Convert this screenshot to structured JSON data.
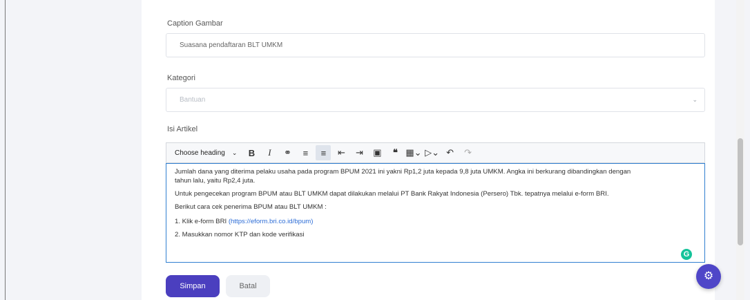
{
  "form": {
    "caption_label": "Caption Gambar",
    "caption_value": "Suasana pendaftaran BLT UMKM",
    "category_label": "Kategori",
    "category_value": "Bantuan",
    "article_label": "Isi Artikel"
  },
  "toolbar": {
    "heading_label": "Choose heading",
    "icons": [
      "bold-icon",
      "italic-icon",
      "link-icon",
      "bulleted-list-icon",
      "numbered-list-icon",
      "outdent-icon",
      "indent-icon",
      "image-icon",
      "quote-icon",
      "table-icon",
      "media-icon",
      "undo-icon",
      "redo-icon"
    ]
  },
  "editor": {
    "p1_a": "Jumlah dana yang diterima pelaku usaha pada program BPUM 2021 ini yakni Rp1,2 juta kepada 9,8 juta UMKM. Angka ini berkurang dibandingkan dengan",
    "p1_b": "tahun lalu, yaitu Rp2,4 juta.",
    "p2": "Untuk pengecekan program BPUM atau BLT UMKM dapat dilakukan melalui PT Bank Rakyat Indonesia (Persero) Tbk. tepatnya melalui e-form BRI.",
    "p3": "Berikut cara cek penerima BPUM atau BLT UMKM :",
    "item1_prefix": "1. Klik e-form BRI ",
    "item1_link": "(https://eform.bri.co.id/bpum)",
    "item2": "2. Masukkan nomor KTP dan kode verifikasi"
  },
  "buttons": {
    "save": "Simpan",
    "cancel": "Batal"
  },
  "colors": {
    "primary": "#4b3fbf",
    "grammarly": "#15c39a",
    "editor_focus": "#2f7fd0"
  }
}
